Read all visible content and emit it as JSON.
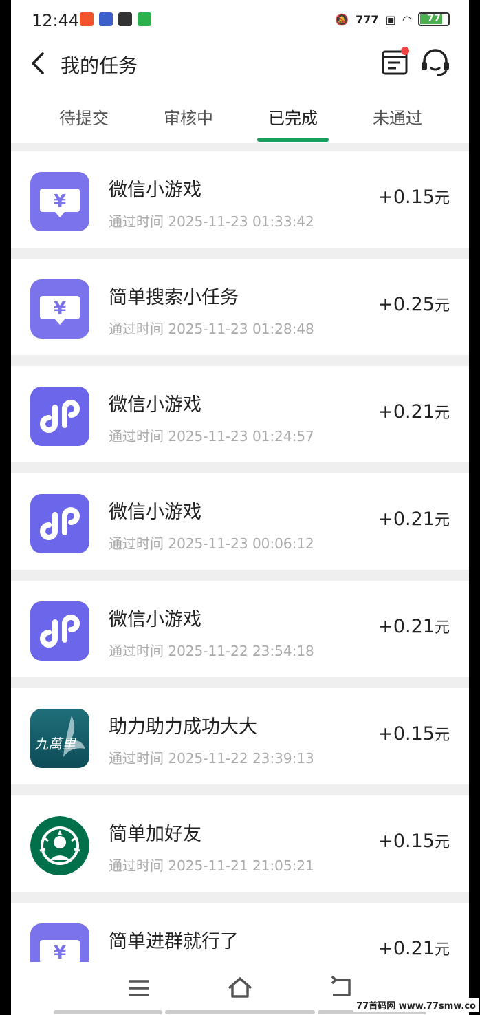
{
  "status": {
    "time": "12:44",
    "battery": "77",
    "signal": "777"
  },
  "header": {
    "title": "我的任务"
  },
  "tabs": [
    {
      "label": "待提交"
    },
    {
      "label": "审核中"
    },
    {
      "label": "已完成",
      "active": true
    },
    {
      "label": "未通过"
    }
  ],
  "tasks": [
    {
      "name": "微信小游戏",
      "time_label": "通过时间",
      "time": "2025-11-23 01:33:42",
      "amount": "+0.15",
      "unit": "元",
      "icon": "yuan-chat-icon"
    },
    {
      "name": "简单搜索小任务",
      "time_label": "通过时间",
      "time": "2025-11-23 01:28:48",
      "amount": "+0.25",
      "unit": "元",
      "icon": "yuan-chat-icon"
    },
    {
      "name": "微信小游戏",
      "time_label": "通过时间",
      "time": "2025-11-23 01:24:57",
      "amount": "+0.21",
      "unit": "元",
      "icon": "mini-program-icon"
    },
    {
      "name": "微信小游戏",
      "time_label": "通过时间",
      "time": "2025-11-23 00:06:12",
      "amount": "+0.21",
      "unit": "元",
      "icon": "mini-program-icon"
    },
    {
      "name": "微信小游戏",
      "time_label": "通过时间",
      "time": "2025-11-22 23:54:18",
      "amount": "+0.21",
      "unit": "元",
      "icon": "mini-program-icon"
    },
    {
      "name": "助力助力成功大大",
      "time_label": "通过时间",
      "time": "2025-11-22 23:39:13",
      "amount": "+0.15",
      "unit": "元",
      "icon": "jiuwanli-logo-icon"
    },
    {
      "name": "简单加好友",
      "time_label": "通过时间",
      "time": "2025-11-21 21:05:21",
      "amount": "+0.15",
      "unit": "元",
      "icon": "starbucks-logo-icon"
    },
    {
      "name": "简单进群就行了",
      "time_label": "",
      "time": "",
      "amount": "+0.21",
      "unit": "元",
      "icon": "yuan-chat-icon"
    }
  ],
  "watermark": "77首码网 www.77smw.co",
  "colors": {
    "accent": "#17a05d",
    "icon_purple": "#7b73ec",
    "badge_red": "#f04444"
  }
}
